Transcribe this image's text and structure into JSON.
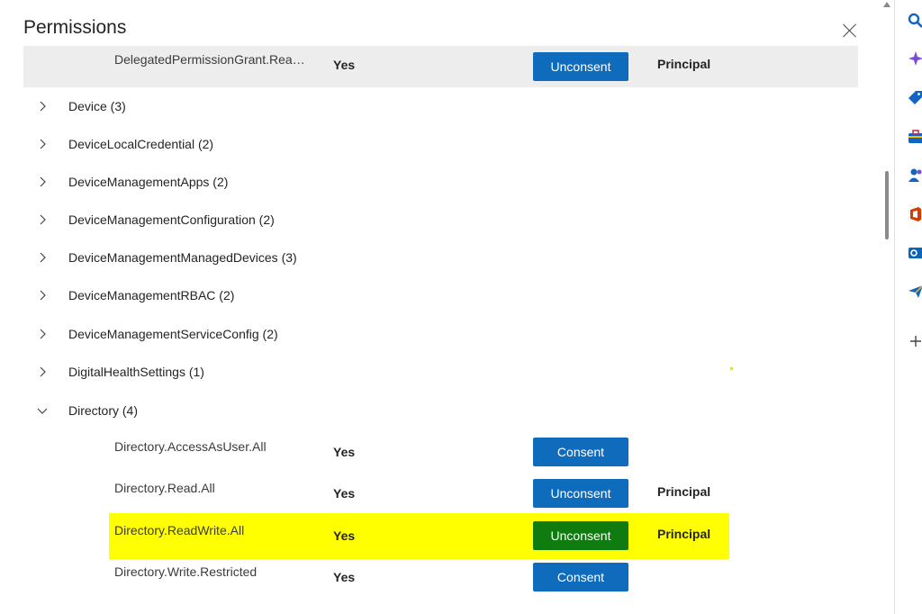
{
  "panel": {
    "title": "Permissions"
  },
  "selected_row": {
    "name": "DelegatedPermissionGrant.Rea…",
    "admin_consent": "Yes",
    "button": "Unconsent",
    "type": "Principal"
  },
  "groups": [
    {
      "label": "Device (3)"
    },
    {
      "label": "DeviceLocalCredential (2)"
    },
    {
      "label": "DeviceManagementApps (2)"
    },
    {
      "label": "DeviceManagementConfiguration (2)"
    },
    {
      "label": "DeviceManagementManagedDevices (3)"
    },
    {
      "label": "DeviceManagementRBAC (2)"
    },
    {
      "label": "DeviceManagementServiceConfig (2)"
    },
    {
      "label": "DigitalHealthSettings (1)"
    }
  ],
  "directory": {
    "label": "Directory (4)",
    "permissions": [
      {
        "name": "Directory.AccessAsUser.All",
        "admin_consent": "Yes",
        "button": "Consent",
        "type": ""
      },
      {
        "name": "Directory.Read.All",
        "admin_consent": "Yes",
        "button": "Unconsent",
        "type": "Principal"
      },
      {
        "name": "Directory.ReadWrite.All",
        "admin_consent": "Yes",
        "button": "Unconsent",
        "type": "Principal",
        "highlighted": true
      },
      {
        "name": "Directory.Write.Restricted",
        "admin_consent": "Yes",
        "button": "Consent",
        "type": ""
      }
    ]
  },
  "colors": {
    "primary_button": "#0f6cbd",
    "highlighted_button": "#107c10",
    "highlight": "#ffff00",
    "selected_row": "#ededed"
  },
  "sidebar": {
    "icons": [
      "search-icon",
      "copilot-sparkle-icon",
      "tag-icon",
      "briefcase-icon",
      "people-icon",
      "office-icon",
      "outlook-icon",
      "send-icon",
      "add-icon"
    ]
  }
}
